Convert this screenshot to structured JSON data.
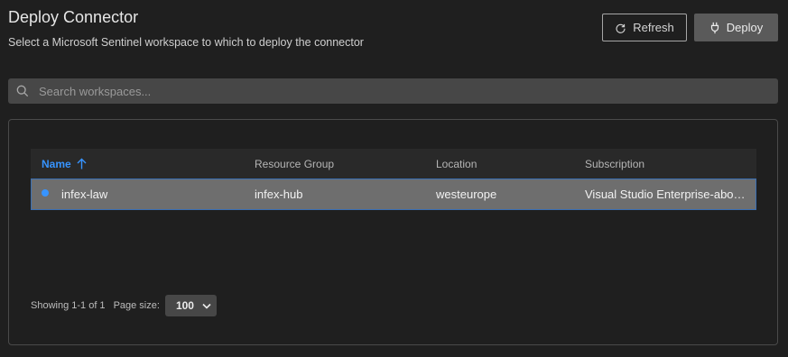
{
  "header": {
    "title": "Deploy Connector",
    "subtitle": "Select a Microsoft Sentinel workspace to which to deploy the connector"
  },
  "toolbar": {
    "refresh_label": "Refresh",
    "refresh_icon": "refresh-icon",
    "deploy_label": "Deploy",
    "deploy_icon": "plug-icon"
  },
  "search": {
    "placeholder": "Search workspaces...",
    "value": "",
    "icon": "search-icon"
  },
  "table": {
    "columns": {
      "name": "Name",
      "resource_group": "Resource Group",
      "location": "Location",
      "subscription": "Subscription"
    },
    "sort_icon": "arrow-up-icon",
    "rows": [
      {
        "name": "infex-law",
        "resource_group": "infex-hub",
        "location": "westeurope",
        "subscription": "Visual Studio Enterprise-abo…",
        "selected": true
      }
    ]
  },
  "pagination": {
    "showing": "Showing 1-1 of 1",
    "page_size_label": "Page size:",
    "page_size_value": "100"
  },
  "colors": {
    "background": "#1f1f1f",
    "accent": "#3794ff",
    "selected_row": "#6e6e6e",
    "selected_border": "#3a6fb4"
  }
}
